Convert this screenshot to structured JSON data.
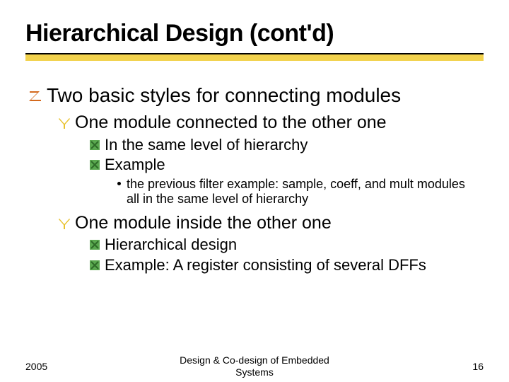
{
  "title": "Hierarchical Design (cont'd)",
  "lvl1": {
    "text": "Two basic styles for connecting modules"
  },
  "lvl2a": {
    "text": "One module connected to the other one"
  },
  "lvl3a1": {
    "text": "In the same level of hierarchy"
  },
  "lvl3a2": {
    "text": "Example"
  },
  "lvl4a": {
    "text": "the previous filter example: sample, coeff, and mult modules all in the same level of hierarchy"
  },
  "lvl2b": {
    "text": "One module inside the other one"
  },
  "lvl3b1": {
    "text": "Hierarchical design"
  },
  "lvl3b2": {
    "text": "Example: A register consisting of several DFFs"
  },
  "footer": {
    "left": "2005",
    "center_line1": "Design & Co-design of Embedded",
    "center_line2": "Systems",
    "right": "16"
  },
  "colors": {
    "bullet_z": "#d46a1e",
    "bullet_y": "#e8c22e",
    "bullet_x": "#5aa84f",
    "underline": "#f2d24d"
  }
}
